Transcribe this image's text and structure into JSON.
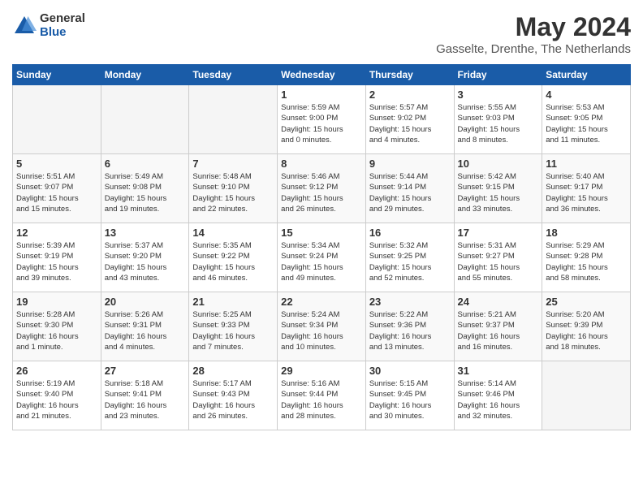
{
  "header": {
    "logo_general": "General",
    "logo_blue": "Blue",
    "month_year": "May 2024",
    "location": "Gasselte, Drenthe, The Netherlands"
  },
  "days_of_week": [
    "Sunday",
    "Monday",
    "Tuesday",
    "Wednesday",
    "Thursday",
    "Friday",
    "Saturday"
  ],
  "weeks": [
    [
      {
        "day": "",
        "info": ""
      },
      {
        "day": "",
        "info": ""
      },
      {
        "day": "",
        "info": ""
      },
      {
        "day": "1",
        "info": "Sunrise: 5:59 AM\nSunset: 9:00 PM\nDaylight: 15 hours\nand 0 minutes."
      },
      {
        "day": "2",
        "info": "Sunrise: 5:57 AM\nSunset: 9:02 PM\nDaylight: 15 hours\nand 4 minutes."
      },
      {
        "day": "3",
        "info": "Sunrise: 5:55 AM\nSunset: 9:03 PM\nDaylight: 15 hours\nand 8 minutes."
      },
      {
        "day": "4",
        "info": "Sunrise: 5:53 AM\nSunset: 9:05 PM\nDaylight: 15 hours\nand 11 minutes."
      }
    ],
    [
      {
        "day": "5",
        "info": "Sunrise: 5:51 AM\nSunset: 9:07 PM\nDaylight: 15 hours\nand 15 minutes."
      },
      {
        "day": "6",
        "info": "Sunrise: 5:49 AM\nSunset: 9:08 PM\nDaylight: 15 hours\nand 19 minutes."
      },
      {
        "day": "7",
        "info": "Sunrise: 5:48 AM\nSunset: 9:10 PM\nDaylight: 15 hours\nand 22 minutes."
      },
      {
        "day": "8",
        "info": "Sunrise: 5:46 AM\nSunset: 9:12 PM\nDaylight: 15 hours\nand 26 minutes."
      },
      {
        "day": "9",
        "info": "Sunrise: 5:44 AM\nSunset: 9:14 PM\nDaylight: 15 hours\nand 29 minutes."
      },
      {
        "day": "10",
        "info": "Sunrise: 5:42 AM\nSunset: 9:15 PM\nDaylight: 15 hours\nand 33 minutes."
      },
      {
        "day": "11",
        "info": "Sunrise: 5:40 AM\nSunset: 9:17 PM\nDaylight: 15 hours\nand 36 minutes."
      }
    ],
    [
      {
        "day": "12",
        "info": "Sunrise: 5:39 AM\nSunset: 9:19 PM\nDaylight: 15 hours\nand 39 minutes."
      },
      {
        "day": "13",
        "info": "Sunrise: 5:37 AM\nSunset: 9:20 PM\nDaylight: 15 hours\nand 43 minutes."
      },
      {
        "day": "14",
        "info": "Sunrise: 5:35 AM\nSunset: 9:22 PM\nDaylight: 15 hours\nand 46 minutes."
      },
      {
        "day": "15",
        "info": "Sunrise: 5:34 AM\nSunset: 9:24 PM\nDaylight: 15 hours\nand 49 minutes."
      },
      {
        "day": "16",
        "info": "Sunrise: 5:32 AM\nSunset: 9:25 PM\nDaylight: 15 hours\nand 52 minutes."
      },
      {
        "day": "17",
        "info": "Sunrise: 5:31 AM\nSunset: 9:27 PM\nDaylight: 15 hours\nand 55 minutes."
      },
      {
        "day": "18",
        "info": "Sunrise: 5:29 AM\nSunset: 9:28 PM\nDaylight: 15 hours\nand 58 minutes."
      }
    ],
    [
      {
        "day": "19",
        "info": "Sunrise: 5:28 AM\nSunset: 9:30 PM\nDaylight: 16 hours\nand 1 minute."
      },
      {
        "day": "20",
        "info": "Sunrise: 5:26 AM\nSunset: 9:31 PM\nDaylight: 16 hours\nand 4 minutes."
      },
      {
        "day": "21",
        "info": "Sunrise: 5:25 AM\nSunset: 9:33 PM\nDaylight: 16 hours\nand 7 minutes."
      },
      {
        "day": "22",
        "info": "Sunrise: 5:24 AM\nSunset: 9:34 PM\nDaylight: 16 hours\nand 10 minutes."
      },
      {
        "day": "23",
        "info": "Sunrise: 5:22 AM\nSunset: 9:36 PM\nDaylight: 16 hours\nand 13 minutes."
      },
      {
        "day": "24",
        "info": "Sunrise: 5:21 AM\nSunset: 9:37 PM\nDaylight: 16 hours\nand 16 minutes."
      },
      {
        "day": "25",
        "info": "Sunrise: 5:20 AM\nSunset: 9:39 PM\nDaylight: 16 hours\nand 18 minutes."
      }
    ],
    [
      {
        "day": "26",
        "info": "Sunrise: 5:19 AM\nSunset: 9:40 PM\nDaylight: 16 hours\nand 21 minutes."
      },
      {
        "day": "27",
        "info": "Sunrise: 5:18 AM\nSunset: 9:41 PM\nDaylight: 16 hours\nand 23 minutes."
      },
      {
        "day": "28",
        "info": "Sunrise: 5:17 AM\nSunset: 9:43 PM\nDaylight: 16 hours\nand 26 minutes."
      },
      {
        "day": "29",
        "info": "Sunrise: 5:16 AM\nSunset: 9:44 PM\nDaylight: 16 hours\nand 28 minutes."
      },
      {
        "day": "30",
        "info": "Sunrise: 5:15 AM\nSunset: 9:45 PM\nDaylight: 16 hours\nand 30 minutes."
      },
      {
        "day": "31",
        "info": "Sunrise: 5:14 AM\nSunset: 9:46 PM\nDaylight: 16 hours\nand 32 minutes."
      },
      {
        "day": "",
        "info": ""
      }
    ]
  ]
}
